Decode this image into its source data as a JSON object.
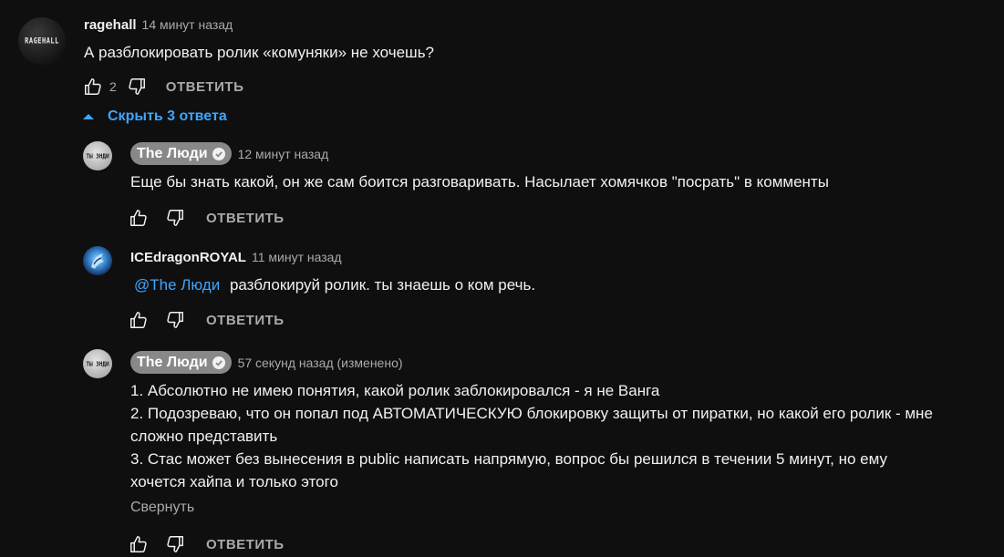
{
  "main_comment": {
    "avatar_text": "RAGEHALL",
    "author": "ragehall",
    "time": "14 минут назад",
    "text": "А разблокировать ролик «комуняки» не хочешь?",
    "likes": "2",
    "reply_label": "ОТВЕТИТЬ"
  },
  "replies_toggle": {
    "label": "Скрыть 3 ответа",
    "icon": "chevron-up-icon"
  },
  "replies": [
    {
      "avatar_text": "ТЫ ЗНДИ",
      "author": "The Люди",
      "verified": true,
      "time": "12 минут назад",
      "text": "Еще бы знать какой, он же сам боится разговаривать. Насылает хомячков \"посрать\" в комменты",
      "reply_label": "ОТВЕТИТЬ"
    },
    {
      "author": "ICEdragonROYAL",
      "time": "11 минут назад",
      "mention": "@The Люди",
      "text": "разблокируй ролик. ты знаешь о ком речь.",
      "reply_label": "ОТВЕТИТЬ"
    },
    {
      "avatar_text": "ТЫ ЗНДИ",
      "author": "The Люди",
      "verified": true,
      "time": "57 секунд назад (изменено)",
      "lines": [
        "1. Абсолютно не имею понятия, какой ролик заблокировался - я не Ванга",
        "2. Подозреваю, что он попал под АВТОМАТИЧЕСКУЮ блокировку защиты от пиратки, но какой его ролик - мне",
        "сложно представить",
        "3. Стас может без вынесения в public написать напрямую, вопрос бы решился в течении 5 минут, но ему",
        "хочется хайпа и только этого"
      ],
      "collapse_label": "Свернуть",
      "reply_label": "ОТВЕТИТЬ"
    }
  ],
  "colors": {
    "background": "#0f0f0f",
    "text": "#f1f1f1",
    "secondary": "#aaaaaa",
    "link": "#3ea6ff",
    "author_chip": "#888888"
  }
}
